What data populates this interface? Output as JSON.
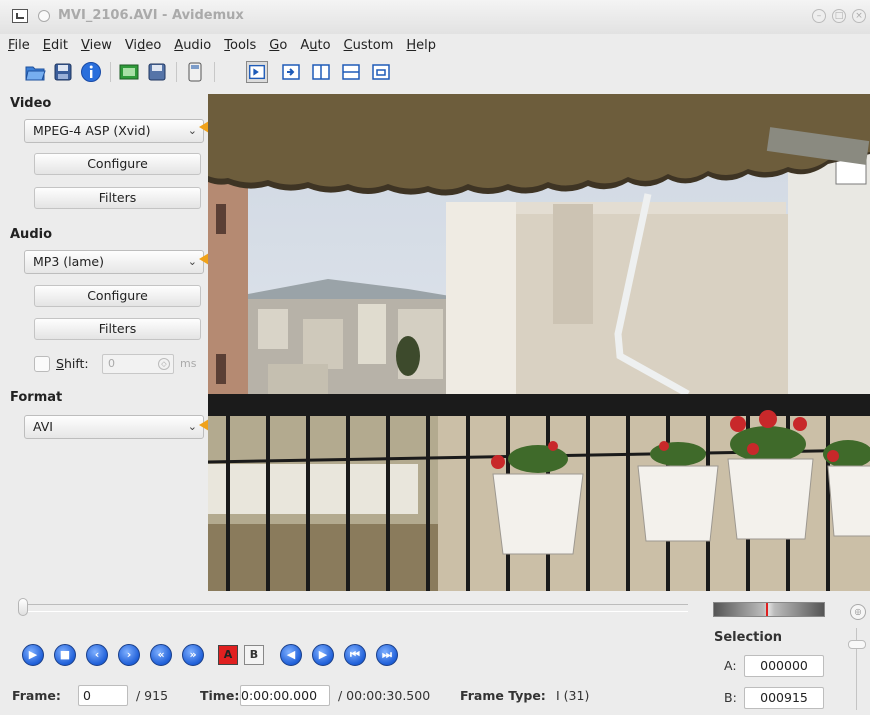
{
  "window": {
    "title": "MVI_2106.AVI - Avidemux"
  },
  "menu": [
    {
      "label": "File",
      "u": "F"
    },
    {
      "label": "Edit",
      "u": "E"
    },
    {
      "label": "View",
      "u": "V"
    },
    {
      "label": "Video",
      "u": "d"
    },
    {
      "label": "Audio",
      "u": "A"
    },
    {
      "label": "Tools",
      "u": "T"
    },
    {
      "label": "Go",
      "u": "G"
    },
    {
      "label": "Auto",
      "u": "u"
    },
    {
      "label": "Custom",
      "u": "C"
    },
    {
      "label": "Help",
      "u": "H"
    }
  ],
  "video_section": {
    "title": "Video",
    "codec": "MPEG-4 ASP (Xvid)",
    "configure_label": "Configure",
    "filters_label": "Filters"
  },
  "audio_section": {
    "title": "Audio",
    "codec": "MP3 (lame)",
    "configure_label": "Configure",
    "filters_label": "Filters",
    "shift_label": "Shift:",
    "shift_value": "0",
    "shift_unit": "ms"
  },
  "format_section": {
    "title": "Format",
    "container": "AVI"
  },
  "selection": {
    "title": "Selection",
    "a_label": "A:",
    "a_value": "000000",
    "b_label": "B:",
    "b_value": "000915"
  },
  "status": {
    "frame_label": "Frame:",
    "frame_value": "0",
    "frame_total": "/ 915",
    "time_label": "Time:",
    "time_value": "0:00:00.000",
    "time_total": "/ 00:00:30.500",
    "frame_type_label": "Frame Type:",
    "frame_type_value": "I (31)"
  },
  "nav_buttons": {
    "mark_a": "A",
    "mark_b": "B"
  },
  "colors": {
    "arrow": "#f0a21a",
    "nav_blue": "#1f5fd8",
    "volume_marker": "#e02020"
  }
}
